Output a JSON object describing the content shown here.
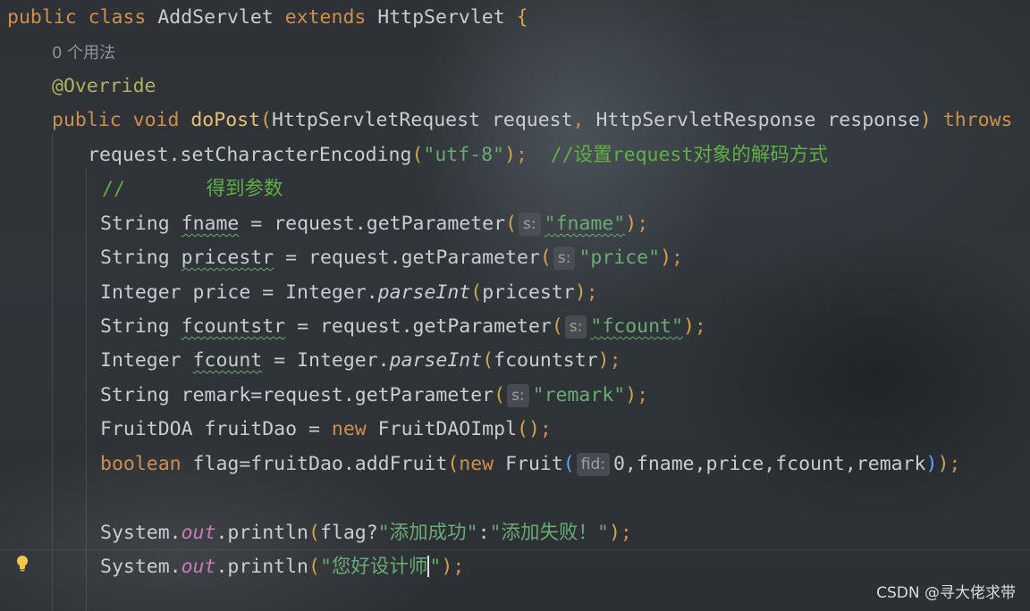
{
  "code": {
    "l1": {
      "kw1": "public",
      "kw2": "class",
      "name": "AddServlet",
      "kw3": "extends",
      "base": "HttpServlet",
      "brace": "{"
    },
    "usage_hint": "0 个用法",
    "annotation": "@Override",
    "l4": {
      "kw1": "public",
      "kw2": "void",
      "method": "doPost",
      "p_open": "(",
      "t1": "HttpServletRequest",
      "v1": "request",
      "comma": ",",
      "t2": "HttpServletResponse",
      "v2": "response",
      "p_close": ")",
      "kw3": "throws"
    },
    "l5": {
      "pre": "request.setCharacterEncoding",
      "p_open": "(",
      "str": "\"utf-8\"",
      "p_close": ")",
      "semi": ";",
      "comment": "//设置request对象的解码方式"
    },
    "l6": {
      "comment_slash": "//",
      "comment_text": "得到参数"
    },
    "l7": {
      "type": "String",
      "var": "fname",
      "rest": " = request.getParameter",
      "p_open": "(",
      "hint": "s:",
      "str": "\"fname\"",
      "p_close": ")",
      "semi": ";"
    },
    "l8": {
      "type": "String",
      "var": "pricestr",
      "rest": " = request.getParameter",
      "p_open": "(",
      "hint": "s:",
      "str": "\"price\"",
      "p_close": ")",
      "semi": ";"
    },
    "l9": {
      "pre": "Integer price = Integer.",
      "method": "parseInt",
      "p_open": "(",
      "arg": "pricestr",
      "p_close": ")",
      "semi": ";"
    },
    "l10": {
      "type": "String",
      "var": "fcountstr",
      "rest": " = request.getParameter",
      "p_open": "(",
      "hint": "s:",
      "str": "\"fcount\"",
      "p_close": ")",
      "semi": ";"
    },
    "l11": {
      "type": "Integer",
      "var": "fcount",
      "rest": " = Integer.",
      "method": "parseInt",
      "p_open": "(",
      "arg": "fcountstr",
      "p_close": ")",
      "semi": ";"
    },
    "l12": {
      "pre": "String remark=request.getParameter",
      "p_open": "(",
      "hint": "s:",
      "str": "\"remark\"",
      "p_close": ")",
      "semi": ";"
    },
    "l13": {
      "pre": "FruitDOA fruitDao = ",
      "kw": "new",
      "cls": " FruitDAOImpl",
      "parens": "()",
      "semi": ";"
    },
    "l14": {
      "kw": "boolean",
      "mid": " flag=fruitDao.addFruit",
      "p_open": "(",
      "kw2": "new",
      "cls": " Fruit",
      "p2_open": "(",
      "hint": "fid:",
      "args": "0,fname,price,fcount,remark",
      "p2_close": ")",
      "p_close": ")",
      "semi": ";"
    },
    "l16": {
      "pre": "System.",
      "field": "out",
      "call": ".println",
      "p_open": "(",
      "arg": "flag?",
      "str1": "\"添加成功\"",
      "colon": ":",
      "str2": "\"添加失败！\"",
      "p_close": ")",
      "semi": ";"
    },
    "l17": {
      "pre": "System.",
      "field": "out",
      "call": ".println",
      "p_open": "(",
      "str_a": "\"您好设计师",
      "str_b": "\"",
      "p_close": ")",
      "semi": ";"
    }
  },
  "watermark": "CSDN @寻大佬求带",
  "icons": {
    "gutter": "lightbulb-icon"
  }
}
